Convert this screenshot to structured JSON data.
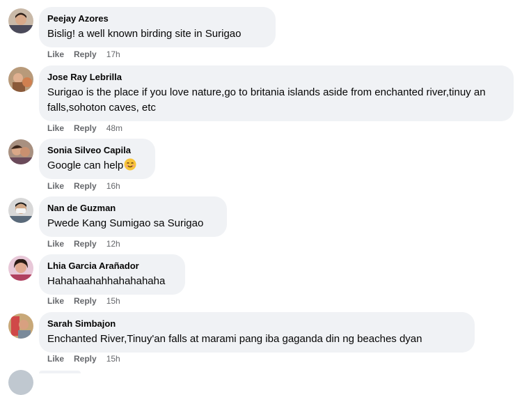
{
  "comments": [
    {
      "author": "Peejay Azores",
      "text": "Bislig! a well known birding site in Surigao",
      "like": "Like",
      "reply": "Reply",
      "time": "17h"
    },
    {
      "author": "Jose Ray Lebrilla",
      "text": "Surigao is the place if you love nature,go to britania islands aside from enchanted river,tinuy an falls,sohoton caves, etc",
      "like": "Like",
      "reply": "Reply",
      "time": "48m"
    },
    {
      "author": "Sonia Silveo Capila",
      "text": "Google can help",
      "emoji": "smiling-face-emoji",
      "like": "Like",
      "reply": "Reply",
      "time": "16h"
    },
    {
      "author": "Nan de Guzman",
      "text": "Pwede Kang Sumigao sa Surigao",
      "like": "Like",
      "reply": "Reply",
      "time": "12h"
    },
    {
      "author": "Lhia Garcia Arañador",
      "text": "Hahahaahahhahahahaha",
      "like": "Like",
      "reply": "Reply",
      "time": "15h"
    },
    {
      "author": "Sarah Simbajon",
      "text": "Enchanted River,Tinuy'an falls at marami pang iba gaganda din ng beaches dyan",
      "like": "Like",
      "reply": "Reply",
      "time": "15h"
    }
  ],
  "colors": {
    "bubble": "#f0f2f5",
    "text": "#050505",
    "secondary": "#65676b"
  }
}
